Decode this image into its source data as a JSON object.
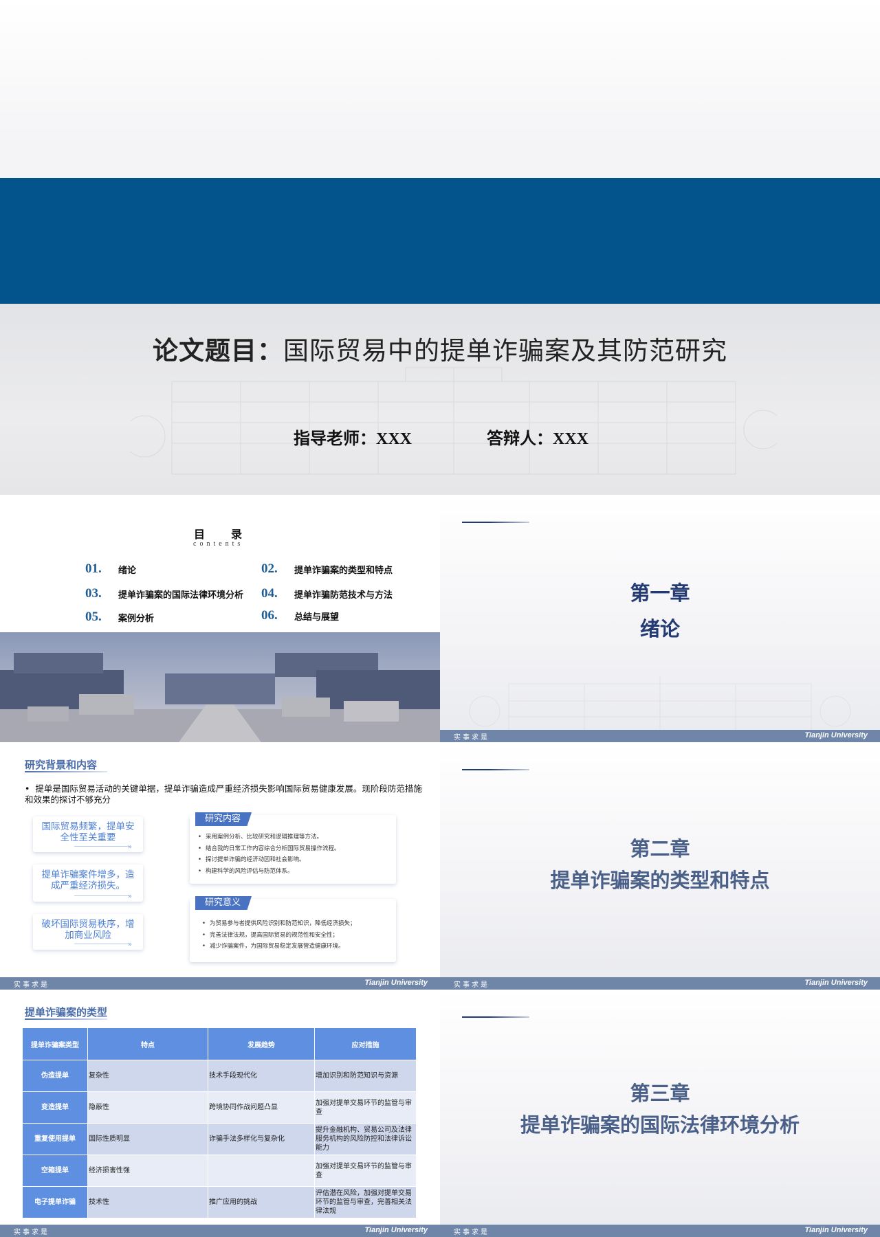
{
  "cover": {
    "title_bold": "论文题目：",
    "title_text": "国际贸易中的提单诈骗案及其防范研究",
    "advisor_label": "指导老师：",
    "advisor_value": "XXX",
    "defender_label": "答辩人：",
    "defender_value": "XXX"
  },
  "footer": {
    "seal": "实事求是",
    "university": "Tianjin University"
  },
  "toc": {
    "heading": "目录",
    "subheading": "contents",
    "items": [
      {
        "num": "01.",
        "label": "绪论"
      },
      {
        "num": "02.",
        "label": "提单诈骗案的类型和特点"
      },
      {
        "num": "03.",
        "label": "提单诈骗案的国际法律环境分析"
      },
      {
        "num": "04.",
        "label": "提单诈骗防范技术与方法"
      },
      {
        "num": "05.",
        "label": "案例分析"
      },
      {
        "num": "06.",
        "label": "总结与展望"
      }
    ]
  },
  "chapters": [
    {
      "chapter": "第一章",
      "title": "绪论"
    },
    {
      "chapter": "第二章",
      "title": "提单诈骗案的类型和特点"
    },
    {
      "chapter": "第三章",
      "title": "提单诈骗案的国际法律环境分析"
    }
  ],
  "background": {
    "section_title": "研究背景和内容",
    "bullet": "提单是国际贸易活动的关键单据，提单诈骗造成严重经济损失影响国际贸易健康发展。现阶段防范措施和效果的探讨不够充分",
    "cards": [
      "国际贸易频繁，提单安全性至关重要",
      "提单诈骗案件增多，造成严重经济损失。",
      "破坏国际贸易秩序，增加商业风险"
    ],
    "content_panel": {
      "tag": "研究内容",
      "items": [
        "采用案例分析、比较研究和逻辑推理等方法。",
        "结合我的日常工作内容综合分析国际贸易操作流程。",
        "探讨提单诈骗的经济动因和社会影响。",
        "构建科学的风险评估与防范体系。"
      ]
    },
    "significance_panel": {
      "tag": "研究意义",
      "items": [
        "为贸易参与者提供风险识别和防范知识，降低经济损失；",
        "完善法律法规，提高国际贸易的规范性和安全性；",
        "减少诈骗案件，为国际贸易稳定发展营造健康环境。"
      ]
    }
  },
  "types": {
    "section_title": "提单诈骗案的类型",
    "headers": [
      "提单诈骗案类型",
      "特点",
      "发展趋势",
      "应对措施"
    ],
    "rows": [
      [
        "伪造提单",
        "复杂性",
        "技术手段现代化",
        "增加识别和防范知识与资源"
      ],
      [
        "变造提单",
        "隐蔽性",
        "跨境协同作战问题凸显",
        "加强对提单交易环节的监管与审查"
      ],
      [
        "重复使用提单",
        "国际性质明显",
        "诈骗手法多样化与复杂化",
        "提升金融机构、贸易公司及法律服务机构的风险防控和法律诉讼能力"
      ],
      [
        "空箱提单",
        "经济损害性强",
        "",
        "加强对提单交易环节的监管与审查"
      ],
      [
        "电子提单诈骗",
        "技术性",
        "推广应用的挑战",
        "评估潜在风险，加强对提单交易环节的监管与审查，完善相关法律法规"
      ]
    ]
  },
  "colors": {
    "brand_blue": "#03548c",
    "footer_blue": "#6f86a8",
    "table_header": "#5e8fe0",
    "chapter_text": "#4a6088"
  }
}
